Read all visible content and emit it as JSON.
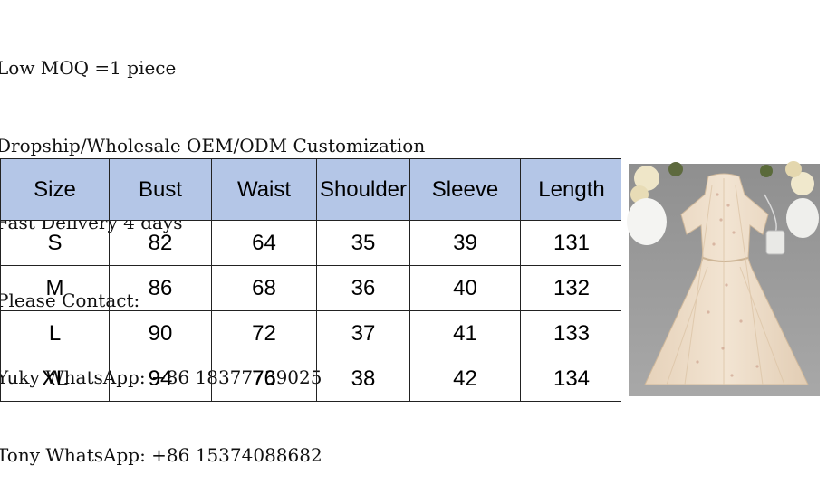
{
  "notes": [
    "Low MOQ =1 piece",
    "Dropship/Wholesale OEM/ODM Customization",
    "Fast Delivery 4 days",
    "Please Contact:",
    "Yuky WhatsApp: +86 18377739025",
    "Tony WhatsApp: +86 15374088682"
  ],
  "table": {
    "headers": [
      "Size",
      "Bust",
      "Waist",
      "Shoulder",
      "Sleeve",
      "Length"
    ],
    "rows": [
      [
        "S",
        "82",
        "64",
        "35",
        "39",
        "131"
      ],
      [
        "M",
        "86",
        "68",
        "36",
        "40",
        "132"
      ],
      [
        "L",
        "90",
        "72",
        "37",
        "41",
        "133"
      ],
      [
        "XL",
        "94",
        "76",
        "38",
        "42",
        "134"
      ]
    ]
  },
  "colors": {
    "header_bg": "#b4c6e7",
    "dress": "#eedcc6",
    "background_gray": "#9a9a9a"
  }
}
